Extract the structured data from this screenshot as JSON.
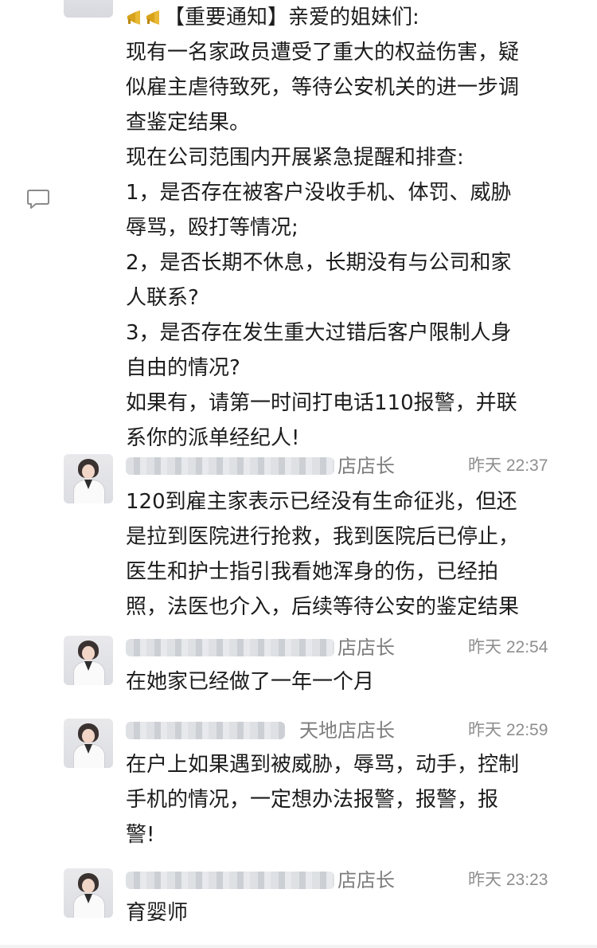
{
  "announcement": {
    "icons": [
      "megaphone-icon",
      "megaphone-icon"
    ],
    "lines": [
      "【重要通知】亲爱的姐妹们:",
      "现有一名家政员遭受了重大的权益伤害，疑",
      "似雇主虐待致死，等待公安机关的进一步调",
      "查鉴定结果。",
      "现在公司范围内开展紧急提醒和排查:",
      "1，是否存在被客户没收手机、体罚、威胁",
      "辱骂，殴打等情况;",
      "2，是否长期不休息，长期没有与公司和家",
      "人联系?",
      "3，是否存在发生重大过错后客户限制人身",
      "自由的情况?",
      "如果有，请第一时间打电话110报警，并联",
      "系你的派单经纪人!"
    ]
  },
  "messages": [
    {
      "sender": "店店长",
      "time": "昨天 22:37",
      "lines": [
        "120到雇主家表示已经没有生命征兆，但还",
        "是拉到医院进行抢救，我到医院后已停止，",
        "医生和护士指引我看她浑身的伤，已经拍",
        "照，法医也介入，后续等待公安的鉴定结果"
      ]
    },
    {
      "sender": "店店长",
      "time": "昨天 22:54",
      "lines": [
        "在她家已经做了一年一个月"
      ]
    },
    {
      "sender": "天地店店长",
      "time": "昨天 22:59",
      "lines": [
        "在户上如果遇到被威胁，辱骂，动手，控制",
        "手机的情况，一定想办法报警，报警，报",
        "警!"
      ]
    },
    {
      "sender": "店店长",
      "time": "昨天 23:23",
      "lines": [
        "育婴师"
      ]
    }
  ],
  "colors": {
    "text": "#1c1c1c",
    "meta": "#8e8e8e",
    "background": "#ffffff",
    "megaphone": "#d8a21a"
  }
}
